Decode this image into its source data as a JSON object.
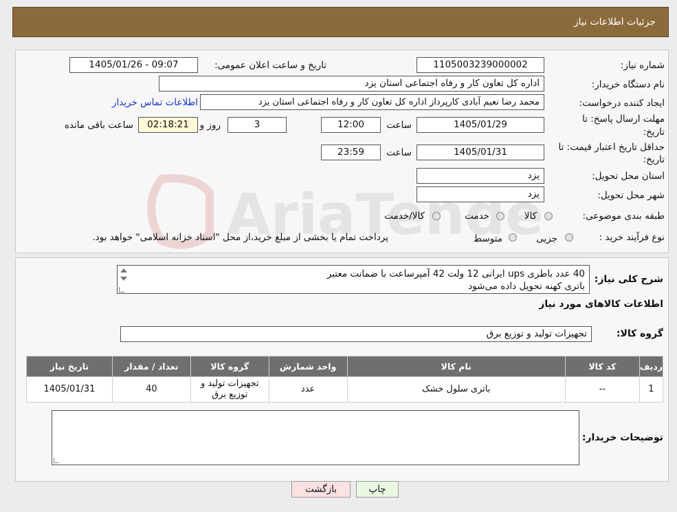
{
  "header": {
    "title": "جزئیات اطلاعات نیاز"
  },
  "fields": {
    "need_number_label": "شماره نیاز:",
    "need_number": "1105003239000002",
    "announce_label": "تاریخ و ساعت اعلان عمومی:",
    "announce_value": "1405/01/26 - 09:07",
    "buyer_org_label": "نام دستگاه خریدار:",
    "buyer_org": "اداره کل تعاون  کار و رفاه اجتماعی استان یزد",
    "requester_label": "ایجاد کننده درخواست:",
    "requester": "محمد رضا  نعیم آبادی کارپرداز اداره کل تعاون  کار و رفاه اجتماعی استان یزد",
    "contact_link": "اطلاعات تماس خریدار",
    "deadline_label_1": "مهلت ارسال پاسخ: تا",
    "deadline_label_2": "تاریخ:",
    "deadline_date": "1405/01/29",
    "time_label": "ساعت",
    "deadline_time": "12:00",
    "days_value": "3",
    "days_label": "روز و",
    "remaining_time": "02:18:21",
    "remaining_label": "ساعت باقی مانده",
    "validity_label_1": "حداقل تاریخ اعتبار قیمت: تا",
    "validity_label_2": "تاریخ:",
    "validity_date": "1405/01/31",
    "validity_time": "23:59",
    "province_label": "استان محل تحویل:",
    "province": "یزد",
    "city_label": "شهر محل تحویل:",
    "city": "یزد",
    "category_label": "طبقه بندی موضوعی:",
    "category_options": [
      "کالا",
      "خدمت",
      "کالا/خدمت"
    ],
    "process_label": "نوع فرآیند خرید :",
    "process_options": [
      "جزیی",
      "متوسط"
    ],
    "process_note": "پرداخت تمام یا بخشی از مبلغ خرید،از محل \"اسناد خزانه اسلامی\" خواهد بود."
  },
  "description": {
    "label": "شرح کلی نیاز:",
    "line1": "40 عدد باطری ups ایرانی 12 ولت 42 آمپرساعت با ضمانت معتبر",
    "line2": "باتری کهنه تحویل داده می‌شود"
  },
  "goods": {
    "section_title": "اطلاعات کالاهای مورد نیاز",
    "group_label": "گروه کالا:",
    "group_value": "تجهیزات تولید و توزیع برق",
    "columns": [
      "ردیف",
      "کد کالا",
      "نام کالا",
      "واحد شمارش",
      "گروه کالا",
      "تعداد / مقدار",
      "تاریخ نیاز"
    ],
    "rows": [
      [
        "1",
        "--",
        "باتری سلول خشک",
        "عدد",
        "تجهیزات تولید و توزیع برق",
        "40",
        "1405/01/31"
      ]
    ]
  },
  "buyer_notes": {
    "label": "توضیحات خریدار:",
    "value": ""
  },
  "buttons": {
    "print": "چاپ",
    "back": "بازگشت"
  },
  "watermark": {
    "text": "AriaTender.neT"
  },
  "colors": {
    "header": "#8b6a3c",
    "table_header": "#6f6f6f",
    "print_btn": "#eaf8e2",
    "back_btn": "#fbe1e1",
    "link": "#1a35c8"
  }
}
